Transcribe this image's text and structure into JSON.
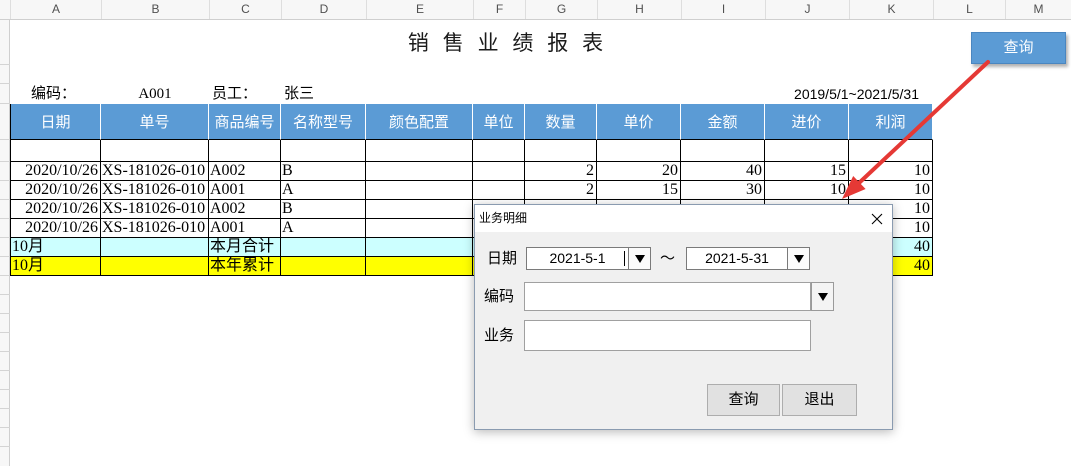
{
  "sheet": {
    "column_headers": [
      "A",
      "B",
      "C",
      "D",
      "E",
      "F",
      "G",
      "H",
      "I",
      "J",
      "K",
      "L",
      "M"
    ],
    "title": "销 售 业 绩 报 表",
    "info": {
      "code_label": "编码：",
      "code_value": "A001",
      "employee_label": "员工：",
      "employee_value": "张三",
      "date_range": "2019/5/1~2021/5/31"
    },
    "table": {
      "headers": [
        "日期",
        "单号",
        "商品编号",
        "名称型号",
        "颜色配置",
        "单位",
        "数量",
        "单价",
        "金额",
        "进价",
        "利润"
      ],
      "rows": [
        [
          "2020/10/26",
          "XS-181026-010",
          "A002",
          "B",
          "",
          "",
          "2",
          "20",
          "40",
          "15",
          "10"
        ],
        [
          "2020/10/26",
          "XS-181026-010",
          "A001",
          "A",
          "",
          "",
          "2",
          "15",
          "30",
          "10",
          "10"
        ],
        [
          "2020/10/26",
          "XS-181026-010",
          "A002",
          "B",
          "",
          "",
          "",
          "",
          "",
          "",
          "10"
        ],
        [
          "2020/10/26",
          "XS-181026-010",
          "A001",
          "A",
          "",
          "",
          "",
          "",
          "",
          "",
          "10"
        ]
      ],
      "summary_rows": [
        {
          "cells": [
            "10月",
            "",
            "本月合计",
            "",
            "",
            "",
            "",
            "",
            "",
            "",
            "40"
          ],
          "fill": "#ccffff"
        },
        {
          "cells": [
            "10月",
            "",
            "本年累计",
            "",
            "",
            "",
            "",
            "",
            "",
            "",
            "40"
          ],
          "fill": "#ffff00"
        }
      ]
    }
  },
  "colors": {
    "header_fill": "#5b9bd5",
    "query_button_fill": "#5b9bd5",
    "arrow": "#e53935"
  },
  "query_button": {
    "label": "查询"
  },
  "dialog": {
    "title": "业务明细",
    "date_label": "日期",
    "date_from": "2021-5-1",
    "date_separator": "～",
    "date_to": "2021-5-31",
    "code_label": "编码",
    "code_value": "",
    "business_label": "业务",
    "business_value": "",
    "query_label": "查询",
    "exit_label": "退出"
  }
}
